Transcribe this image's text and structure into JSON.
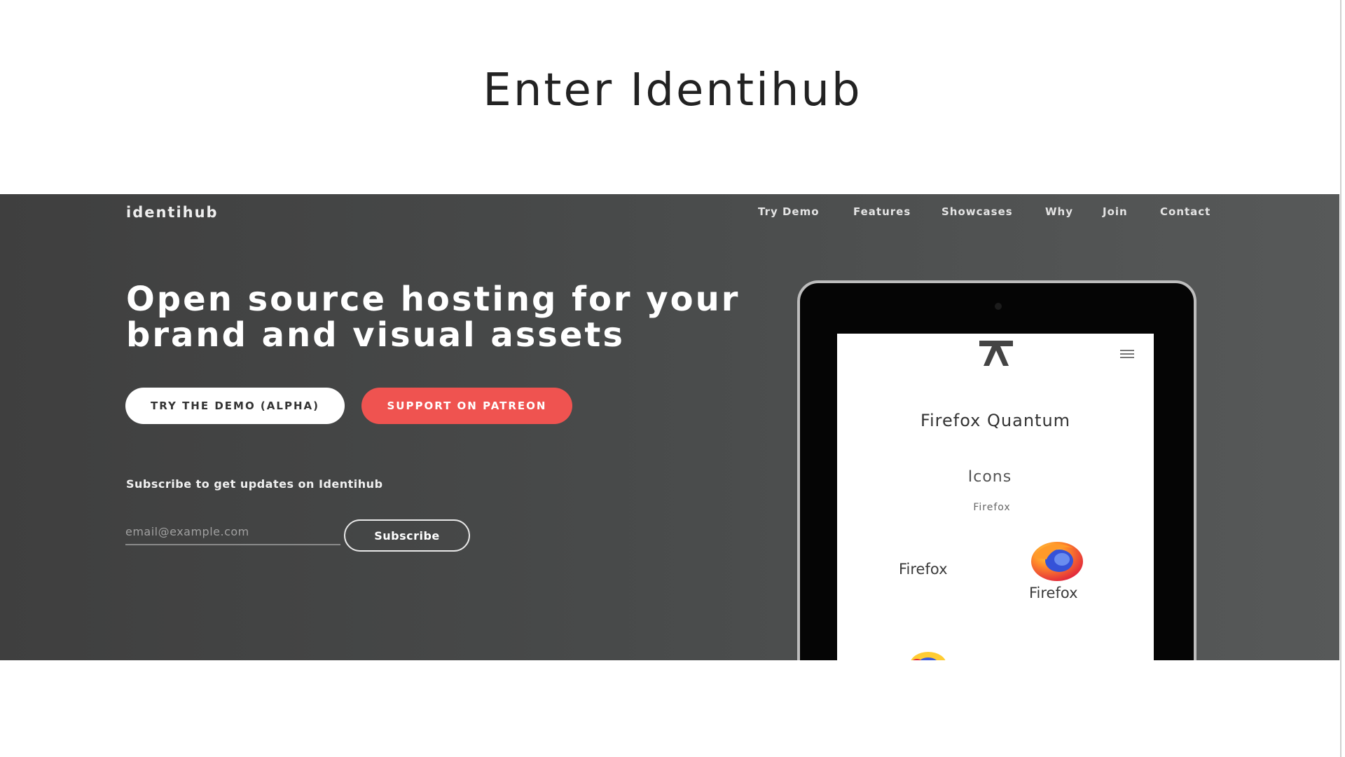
{
  "slide": {
    "title": "Enter Identihub"
  },
  "site": {
    "brand": "identihub",
    "nav": [
      "Try Demo",
      "Features",
      "Showcases",
      "Why",
      "Join",
      "Contact"
    ],
    "headline_line1": "Open source hosting for your",
    "headline_line2": "brand and visual assets",
    "cta_demo": "TRY THE DEMO (ALPHA)",
    "cta_patreon": "SUPPORT ON PATREON",
    "subscribe_label": "Subscribe to get updates on Identihub",
    "email_placeholder": "email@example.com",
    "subscribe_button": "Subscribe"
  },
  "tablet_screen": {
    "title": "Firefox Quantum",
    "subtitle": "Icons",
    "tag": "Firefox",
    "wordmark_left": "Firefox",
    "wordmark_right": "Firefox"
  },
  "colors": {
    "hero_background": "#4a4c4c",
    "patreon_button": "#ef5350",
    "demo_button": "#ffffff"
  },
  "icons": [
    "identihub-logo-icon",
    "hamburger-menu-icon",
    "firefox-logo-icon"
  ]
}
